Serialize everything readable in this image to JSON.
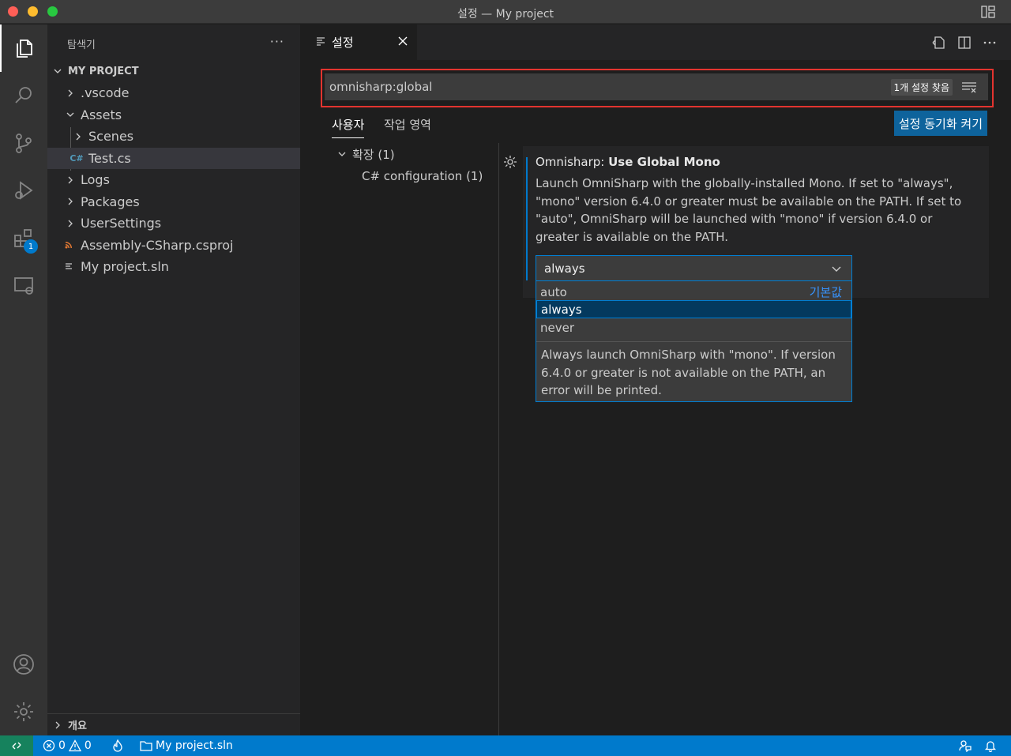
{
  "window": {
    "title": "설정 — My project"
  },
  "sidebar": {
    "header": "탐색기",
    "more": "···",
    "section": "MY PROJECT",
    "items": [
      {
        "label": ".vscode",
        "kind": "folder",
        "expanded": false,
        "depth": 0
      },
      {
        "label": "Assets",
        "kind": "folder",
        "expanded": true,
        "depth": 0
      },
      {
        "label": "Scenes",
        "kind": "folder",
        "expanded": false,
        "depth": 1
      },
      {
        "label": "Test.cs",
        "kind": "csharp",
        "depth": 1,
        "selected": true
      },
      {
        "label": "Logs",
        "kind": "folder",
        "expanded": false,
        "depth": 0
      },
      {
        "label": "Packages",
        "kind": "folder",
        "expanded": false,
        "depth": 0
      },
      {
        "label": "UserSettings",
        "kind": "folder",
        "expanded": false,
        "depth": 0
      },
      {
        "label": "Assembly-CSharp.csproj",
        "kind": "rss",
        "depth": 0
      },
      {
        "label": "My project.sln",
        "kind": "list",
        "depth": 0
      }
    ],
    "outline": "개요"
  },
  "activity": {
    "extensions_badge": "1"
  },
  "editor": {
    "tab_label": "설정",
    "search": {
      "value": "omnisharp:global",
      "count": "1개 설정 찾음"
    },
    "scopes": {
      "user": "사용자",
      "workspace": "작업 영역"
    },
    "sync_button": "설정 동기화 켜기",
    "toc": {
      "extensions": "확장 (1)",
      "csharp": "C# configuration (1)"
    },
    "setting": {
      "category": "Omnisharp: ",
      "name": "Use Global Mono",
      "description": "Launch OmniSharp with the globally-installed Mono. If set to \"always\", \"mono\" version 6.4.0 or greater must be available on the PATH. If set to \"auto\", OmniSharp will be launched with \"mono\" if version 6.4.0 or greater is available on the PATH.",
      "selected_value": "always",
      "options": [
        "auto",
        "always",
        "never"
      ],
      "default_label": "기본값",
      "option_description": "Always launch OmniSharp with \"mono\". If version 6.4.0 or greater is not available on the PATH, an error will be printed."
    }
  },
  "statusbar": {
    "errors": "0",
    "warnings": "0",
    "project": "My project.sln"
  }
}
